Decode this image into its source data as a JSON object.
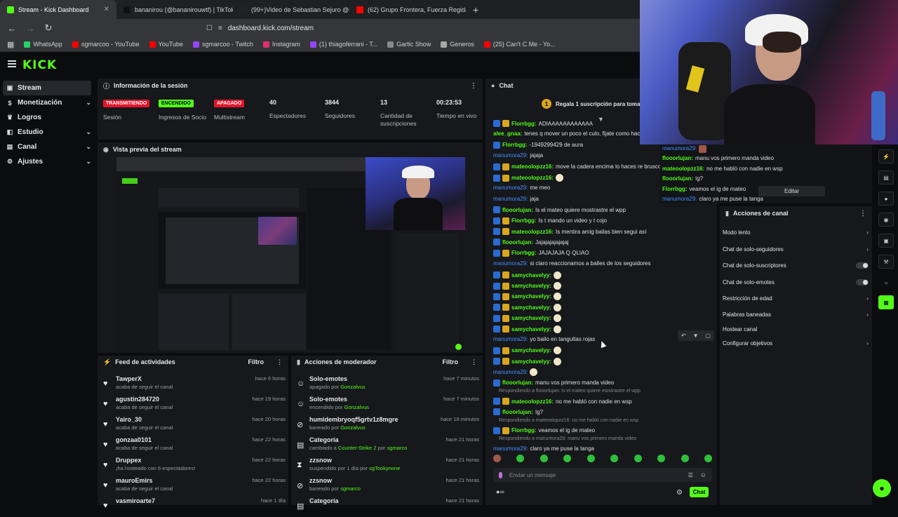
{
  "browser": {
    "tabs": [
      {
        "title": "Stream - Kick Dashboard",
        "color": "#53fc18"
      },
      {
        "title": "bananirou (@bananirouwtf) | TikTok",
        "color": "#111111"
      },
      {
        "title": "(99+)Video de Sebastian Sejuro @s",
        "color": "#222222"
      },
      {
        "title": "(62) Grupo Frontera, Fuerza Regida",
        "color": "#ff0000"
      }
    ],
    "url": "dashboard.kick.com/stream",
    "bookmarks": [
      {
        "label": "WhatsApp",
        "color": "#25d366"
      },
      {
        "label": "sgmarcoo - YouTube",
        "color": "#ff0000"
      },
      {
        "label": "YouTube",
        "color": "#ff0000"
      },
      {
        "label": "sgmarcoo - Twitch",
        "color": "#9146ff"
      },
      {
        "label": "Instagram",
        "color": "#e1306c"
      },
      {
        "label": "(1) thiagoferrani - T...",
        "color": "#9146ff"
      },
      {
        "label": "Gartic Show",
        "color": "#888888"
      },
      {
        "label": "Generos",
        "color": "#aaaaaa"
      },
      {
        "label": "(25) Can't C Me - Yo...",
        "color": "#ff0000"
      }
    ]
  },
  "kick": {
    "logo": "KICK",
    "sidebar": [
      {
        "label": "Stream",
        "icon": "video-icon",
        "chevron": false,
        "active": true
      },
      {
        "label": "Monetización",
        "icon": "dollar-icon",
        "chevron": true,
        "active": false
      },
      {
        "label": "Logros",
        "icon": "trophy-icon",
        "chevron": false,
        "active": false
      },
      {
        "label": "Estudio",
        "icon": "studio-icon",
        "chevron": true,
        "active": false
      },
      {
        "label": "Canal",
        "icon": "channel-icon",
        "chevron": true,
        "active": false
      },
      {
        "label": "Ajustes",
        "icon": "gear-icon",
        "chevron": true,
        "active": false
      }
    ],
    "session": {
      "title": "Información de la sesión",
      "stats": [
        {
          "pill": "TRANSMITIENDO",
          "pill_color": "red",
          "label": "Sesión"
        },
        {
          "pill": "ENCENDIDO",
          "pill_color": "green",
          "label": "Ingresos de Socio"
        },
        {
          "pill": "APAGADO",
          "pill_color": "red",
          "label": "Multistream"
        },
        {
          "value": "40",
          "label": "Espectadores"
        },
        {
          "value": "3844",
          "label": "Seguidores"
        },
        {
          "value": "13",
          "label": "Cantidad de suscripciones"
        },
        {
          "value": "00:23:53",
          "label": "Tiempo en vivo"
        }
      ]
    },
    "preview": {
      "title": "Vista previa del stream"
    },
    "feed": {
      "title": "Feed de actividades",
      "filter": "Filtro",
      "items": [
        {
          "name": "TawperX",
          "sub": "acaba de seguir el canal",
          "time": "hace 6 horas"
        },
        {
          "name": "agustin284720",
          "sub": "acaba de seguir el canal",
          "time": "hace 19 horas"
        },
        {
          "name": "Yairo_30",
          "sub": "acaba de seguir el canal",
          "time": "hace 20 horas"
        },
        {
          "name": "gonzaa0101",
          "sub": "acaba de seguir el canal",
          "time": "hace 22 horas"
        },
        {
          "name": "Druppex",
          "sub": "¡ha hosteado con 6 espectadores!",
          "time": "hace 22 horas"
        },
        {
          "name": "mauroEmirs",
          "sub": "acaba de seguir el canal",
          "time": "hace 22 horas"
        },
        {
          "name": "vasmiroarte7",
          "sub": "",
          "time": "hace 1 día"
        }
      ]
    },
    "modactions": {
      "title": "Acciones de moderador",
      "filter": "Filtro",
      "items": [
        {
          "name": "Solo-emotes",
          "sub": "apagado por Gonzalvus",
          "time": "hace 7 minutos"
        },
        {
          "name": "Solo-emotes",
          "sub": "encendido por Gonzalvus",
          "time": "hace 7 minutos"
        },
        {
          "name": "humidembryoqf5grtv1z8mgre",
          "sub": "baneado por Gonzalvus",
          "time": "hace 18 minutos"
        },
        {
          "name": "Categoría",
          "sub": "cambiado a Counter-Strike 2 por sgmarco",
          "time": "hace 21 horas"
        },
        {
          "name": "zzsnow",
          "sub": "suspendido por 1 día por sgTookynone",
          "time": "hace 21 horas"
        },
        {
          "name": "zzsnow",
          "sub": "baneado por sgmarco",
          "time": "hace 21 horas"
        },
        {
          "name": "Categoría",
          "sub": "",
          "time": "hace 21 horas"
        }
      ]
    },
    "chat": {
      "title": "Chat",
      "banner": "Regala 1 suscripción para tomar la p",
      "messages": [
        {
          "user": "Florrbgg:",
          "text": "ADIAAAAAAAAAAAA",
          "color": "green",
          "badges": 2
        },
        {
          "user": "alee_gnaa:",
          "text": "tenes q mover un poco el culo, fijate como hace en e",
          "color": "green",
          "badges": 0
        },
        {
          "user": "Florrbgg:",
          "text": "-1949299429 de aura",
          "color": "green",
          "badges": 1
        },
        {
          "user": "manumora29:",
          "text": "jajaja",
          "color": "blue",
          "badges": 0
        },
        {
          "user": "mateoolopzz16:",
          "text": "move la cadera encima lo haces re brusco",
          "color": "green",
          "badges": 2
        },
        {
          "user": "mateoolopzz16:",
          "text": "",
          "color": "green",
          "badges": 2
        },
        {
          "user": "manumora29:",
          "text": "me meo",
          "color": "blue",
          "badges": 0
        },
        {
          "user": "manumora29:",
          "text": "jaja",
          "color": "blue",
          "badges": 0
        },
        {
          "user": "flooorlujan:",
          "text": "Is el mateo quiere mostrastre el wpp",
          "color": "green",
          "badges": 1
        },
        {
          "user": "Florrbgg:",
          "text": "Is t mando un video y t cojo",
          "color": "green",
          "badges": 2
        },
        {
          "user": "mateoolopzz16:",
          "text": "Is mentira amig bailas bien segui así",
          "color": "green",
          "badges": 2
        },
        {
          "user": "flooorlujan:",
          "text": "Jajajajajajajaj",
          "color": "green",
          "badges": 1
        },
        {
          "user": "Florrbgg:",
          "text": "JAJAJAJA Q QLIAO",
          "color": "green",
          "badges": 2
        },
        {
          "user": "manumora29:",
          "text": "si claro reaccionamos a balles de los seguidores",
          "color": "blue",
          "badges": 0
        },
        {
          "user": "samychavelyy:",
          "text": "",
          "color": "green",
          "badges": 2
        },
        {
          "user": "samychavelyy:",
          "text": "",
          "color": "green",
          "badges": 2
        },
        {
          "user": "samychavelyy:",
          "text": "",
          "color": "green",
          "badges": 2
        },
        {
          "user": "samychavelyy:",
          "text": "",
          "color": "green",
          "badges": 2
        },
        {
          "user": "samychavelyy:",
          "text": "",
          "color": "green",
          "badges": 2
        },
        {
          "user": "samychavelyy:",
          "text": "",
          "color": "green",
          "badges": 2
        },
        {
          "user": "manumora29:",
          "text": "yo bailo en tangultas rojas",
          "color": "blue",
          "badges": 0
        },
        {
          "user": "samychavelyy:",
          "text": "",
          "color": "green",
          "badges": 2
        },
        {
          "user": "samychavelyy:",
          "text": "",
          "color": "green",
          "badges": 2
        },
        {
          "user": "manumora29:",
          "text": "",
          "color": "blue",
          "badges": 0
        },
        {
          "user": "flooorlujan:",
          "text": "manu vos primero manda video",
          "color": "green",
          "badges": 1
        },
        {
          "reply": "Respondiendo a flooorlujan: Is el mateo quiere mostrastre el wpp"
        },
        {
          "user": "mateoolopzz16:",
          "text": "no me habló con nadie en wsp",
          "color": "green",
          "badges": 2
        },
        {
          "user": "flooorlujan:",
          "text": "Ig?",
          "color": "green",
          "badges": 1
        },
        {
          "reply": "Respondiendo a mateoolopzz16: no me habló con nadie en wsp"
        },
        {
          "user": "Florrbgg:",
          "text": "veamos el ig de mateo",
          "color": "green",
          "badges": 2
        },
        {
          "reply": "Respondiendo a manumora29: manu vos primero manda video"
        },
        {
          "user": "manumora29:",
          "text": "claro ya me puse la tanga",
          "color": "blue",
          "badges": 0
        }
      ],
      "input_placeholder": "Enviar un mensaje",
      "send_label": "Chat"
    },
    "side_chat": [
      {
        "user": "manumora29:",
        "text": "",
        "color": "blue"
      },
      {
        "user": "flooorlujan:",
        "text": "manu vos primero manda video",
        "color": "green"
      },
      {
        "user": "mateoolopzz16:",
        "text": "no me habló con nadie en wsp",
        "color": "green"
      },
      {
        "user": "flooorlujan:",
        "text": "Ig?",
        "color": "green"
      },
      {
        "user": "Florrbgg:",
        "text": "veamos el ig de mateo",
        "color": "green"
      },
      {
        "user": "manumora29:",
        "text": "claro ya me puse la tanga",
        "color": "blue"
      }
    ],
    "edit_label": "Editar",
    "channel_actions": {
      "title": "Acciones de canal",
      "items": [
        {
          "label": "Modo lento",
          "end": "chevron"
        },
        {
          "label": "Chat de solo-seguidores",
          "end": "chevron"
        },
        {
          "label": "Chat de solo-suscriptores",
          "end": "toggle"
        },
        {
          "label": "Chat de solo-emotes",
          "end": "toggle"
        },
        {
          "label": "Restricción de edad",
          "end": "chevron"
        },
        {
          "label": "Palabras baneadas",
          "end": "chevron"
        },
        {
          "label": "Hostear canal",
          "end": "none"
        },
        {
          "label": "Configurar objetivos",
          "end": "chevron"
        }
      ]
    },
    "colors": {
      "accent": "#53fc18",
      "live_red": "#e4162a",
      "user_blue": "#4a8dff"
    }
  }
}
